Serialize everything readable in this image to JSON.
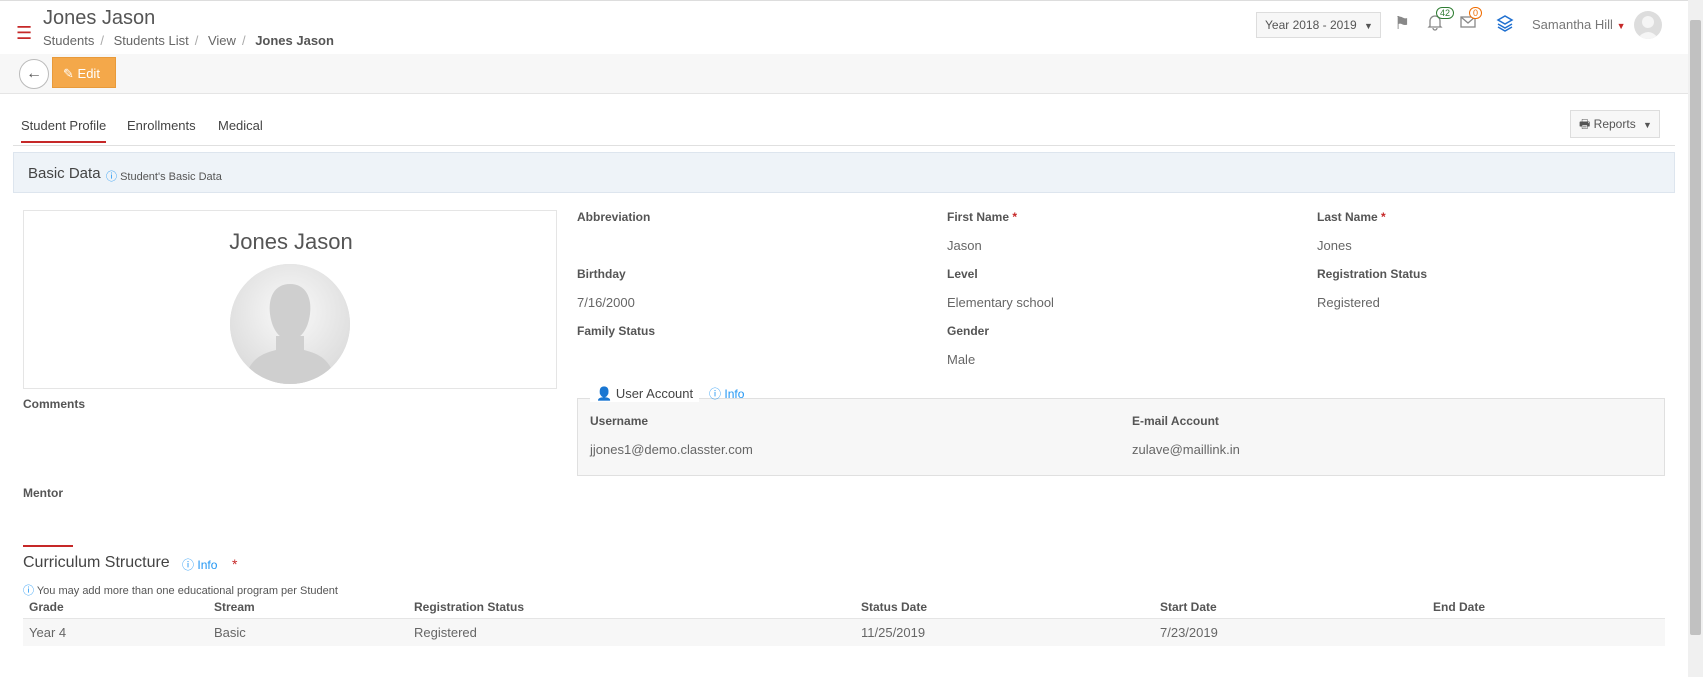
{
  "header": {
    "title": "Jones Jason",
    "breadcrumb": [
      "Students",
      "Students List",
      "View",
      "Jones Jason"
    ],
    "year_select": "Year 2018 - 2019",
    "notifications_count": "42",
    "messages_count": "0",
    "user_name": "Samantha Hill"
  },
  "toolbar": {
    "edit_label": "Edit"
  },
  "tabs": [
    {
      "label": "Student Profile",
      "active": true
    },
    {
      "label": "Enrollments"
    },
    {
      "label": "Medical"
    }
  ],
  "reports_label": "Reports",
  "section": {
    "title": "Basic Data",
    "subtitle": "Student's Basic Data"
  },
  "profile": {
    "name": "Jones Jason"
  },
  "fields": {
    "abbreviation": {
      "label": "Abbreviation",
      "value": ""
    },
    "first_name": {
      "label": "First Name",
      "value": "Jason"
    },
    "last_name": {
      "label": "Last Name",
      "value": "Jones"
    },
    "birthday": {
      "label": "Birthday",
      "value": "7/16/2000"
    },
    "level": {
      "label": "Level",
      "value": "Elementary school"
    },
    "registration_status": {
      "label": "Registration Status",
      "value": "Registered"
    },
    "family_status": {
      "label": "Family Status",
      "value": ""
    },
    "gender": {
      "label": "Gender",
      "value": "Male"
    },
    "comments": {
      "label": "Comments",
      "value": ""
    },
    "mentor": {
      "label": "Mentor",
      "value": ""
    }
  },
  "user_account": {
    "legend": "User Account",
    "info_label": "Info",
    "username_label": "Username",
    "username_value": "jjones1@demo.classter.com",
    "email_label": "E-mail Account",
    "email_value": "zulave@maillink.in"
  },
  "curriculum": {
    "title": "Curriculum Structure",
    "info_label": "Info",
    "hint": "You may add more than one educational program per Student",
    "columns": [
      "Grade",
      "Stream",
      "Registration Status",
      "Status Date",
      "Start Date",
      "End Date"
    ],
    "rows": [
      [
        "Year 4",
        "Basic",
        "Registered",
        "11/25/2019",
        "7/23/2019",
        ""
      ]
    ]
  },
  "colors": {
    "accent": "#c62828",
    "edit": "#f4a84a",
    "link": "#2196f3"
  }
}
